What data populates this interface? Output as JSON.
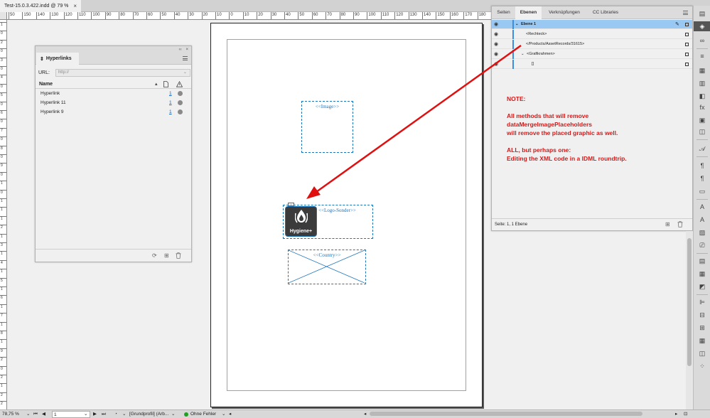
{
  "document_tab": {
    "title": "Test-15.0.3.422.indd @ 79 %",
    "close": "×"
  },
  "hruler_labels": [
    "50",
    "150",
    "140",
    "130",
    "120",
    "110",
    "100",
    "90",
    "80",
    "70",
    "60",
    "50",
    "40",
    "30",
    "20",
    "10",
    "0",
    "10",
    "20",
    "30",
    "40",
    "50",
    "60",
    "70",
    "80",
    "90",
    "100",
    "110",
    "120",
    "130",
    "140",
    "150",
    "160",
    "170",
    "180",
    "190",
    "200",
    "210",
    "220",
    "230",
    "240",
    "250",
    "260",
    "270",
    "280",
    "290",
    "300",
    "310",
    "320",
    "330",
    "340",
    "350"
  ],
  "vruler_labels": [
    "1",
    "0",
    "2",
    "0",
    "3",
    "0",
    "4",
    "0",
    "5",
    "0",
    "6",
    "0",
    "7",
    "0",
    "8",
    "0",
    "9",
    "0",
    "1",
    "0",
    "1",
    "1",
    "1",
    "2",
    "1",
    "3",
    "1",
    "4",
    "1",
    "5",
    "1",
    "6",
    "1",
    "7",
    "1",
    "8",
    "1",
    "9",
    "2",
    "0",
    "2",
    "1",
    "2",
    "2"
  ],
  "canvas": {
    "image_frame_label": "<<Image>>",
    "logo_frame_label": "<<Logo-Sonder>>",
    "logo_word": "Hygiene+",
    "logo_badge": "∞",
    "country_frame_label": "<<Country>>"
  },
  "hyperlinks_panel": {
    "title": "Hyperlinks",
    "collapse": "‹‹",
    "close": "×",
    "url_label": "URL:",
    "url_placeholder": "http://",
    "col_name": "Name",
    "col_sort": "▴",
    "col_page_icon": "page-icon",
    "col_warning_icon": "warning-icon",
    "rows": [
      {
        "name": "Hyperlink",
        "page": "1"
      },
      {
        "name": "Hyperlink 11",
        "page": "1"
      },
      {
        "name": "Hyperlink 9",
        "page": "1"
      }
    ]
  },
  "layers_panel": {
    "tabs": [
      "Seiten",
      "Ebenen",
      "Verknüpfungen",
      "CC Libraries"
    ],
    "active_tab": "Ebenen",
    "rows": [
      {
        "label": "Ebene 1",
        "expander": "⌄",
        "selected": true
      },
      {
        "label": "<Rechteck>",
        "expander": ""
      },
      {
        "label": "</Products/AssetRecords/31615>",
        "expander": ""
      },
      {
        "label": "<Grafikrahmen>",
        "expander": "⌄"
      },
      {
        "label": "[]",
        "expander": ""
      }
    ],
    "status": "Seite: 1, 1 Ebene"
  },
  "note": {
    "heading": "NOTE:",
    "line1": "All methods that will remove",
    "line2": "dataMergeImagePlaceholders",
    "line3": "will remove the placed graphic as well.",
    "line4": "ALL, but perhaps one:",
    "line5": "Editing the XML code in a IDML roundtrip."
  },
  "statusbar": {
    "zoom": "78,75 %",
    "page": "1",
    "profile": "[Grundprofil] (Arb...",
    "preflight": "Ohne Fehler"
  },
  "colors": {
    "frame_blue": "#1e74b8",
    "margin_magenta": "#d27be8",
    "note_red": "#d01c1c",
    "arrow_red": "#e01010",
    "selection_blue": "#99c8f2"
  }
}
